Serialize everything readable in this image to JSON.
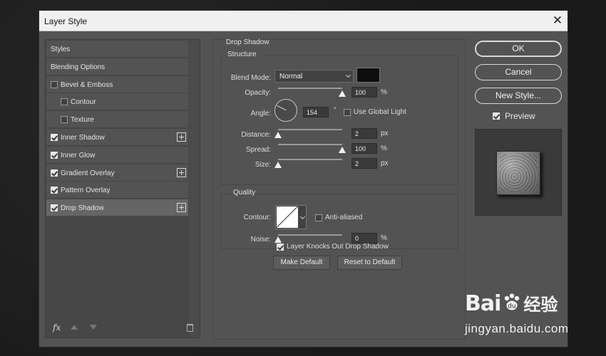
{
  "window": {
    "title": "Layer Style"
  },
  "left_panel": {
    "items": [
      {
        "label": "Styles",
        "has_checkbox": false,
        "checked": false,
        "has_add": false,
        "indent": false,
        "active": false
      },
      {
        "label": "Blending Options",
        "has_checkbox": false,
        "checked": false,
        "has_add": false,
        "indent": false,
        "active": false
      },
      {
        "label": "Bevel & Emboss",
        "has_checkbox": true,
        "checked": false,
        "has_add": false,
        "indent": false,
        "active": false
      },
      {
        "label": "Contour",
        "has_checkbox": true,
        "checked": false,
        "has_add": false,
        "indent": true,
        "active": false
      },
      {
        "label": "Texture",
        "has_checkbox": true,
        "checked": false,
        "has_add": false,
        "indent": true,
        "active": false
      },
      {
        "label": "Inner Shadow",
        "has_checkbox": true,
        "checked": true,
        "has_add": true,
        "indent": false,
        "active": false
      },
      {
        "label": "Inner Glow",
        "has_checkbox": true,
        "checked": true,
        "has_add": false,
        "indent": false,
        "active": false
      },
      {
        "label": "Gradient Overlay",
        "has_checkbox": true,
        "checked": true,
        "has_add": true,
        "indent": false,
        "active": false
      },
      {
        "label": "Pattern Overlay",
        "has_checkbox": true,
        "checked": true,
        "has_add": false,
        "indent": false,
        "active": false
      },
      {
        "label": "Drop Shadow",
        "has_checkbox": true,
        "checked": true,
        "has_add": true,
        "indent": false,
        "active": true
      }
    ],
    "fx_label": "fx"
  },
  "drop_shadow": {
    "title": "Drop Shadow",
    "structure": {
      "title": "Structure",
      "blend_mode": {
        "label": "Blend Mode:",
        "value": "Normal",
        "color": "#0e0e0e"
      },
      "opacity": {
        "label": "Opacity:",
        "value": "100",
        "unit": "%",
        "level": 1.0
      },
      "angle": {
        "label": "Angle:",
        "value": "154",
        "unit": "°",
        "use_global_light": "Use Global Light",
        "use_global_checked": false
      },
      "distance": {
        "label": "Distance:",
        "value": "2",
        "unit": "px",
        "level": 0.0
      },
      "spread": {
        "label": "Spread:",
        "value": "100",
        "unit": "%",
        "level": 1.0
      },
      "size": {
        "label": "Size:",
        "value": "2",
        "unit": "px",
        "level": 0.0
      }
    },
    "quality": {
      "title": "Quality",
      "contour_label": "Contour:",
      "anti_aliased": "Anti-aliased",
      "anti_aliased_checked": false,
      "noise": {
        "label": "Noise:",
        "value": "0",
        "unit": "%",
        "level": 0.0
      }
    },
    "knocks_out": {
      "label": "Layer Knocks Out Drop Shadow",
      "checked": true
    },
    "make_default": "Make Default",
    "reset_default": "Reset to Default"
  },
  "actions": {
    "ok": "OK",
    "cancel": "Cancel",
    "new_style": "New Style...",
    "preview": {
      "label": "Preview",
      "checked": true
    }
  },
  "watermark": {
    "brand": "Bai",
    "brand_cn": "经验",
    "url": "jingyan.baidu.com"
  }
}
